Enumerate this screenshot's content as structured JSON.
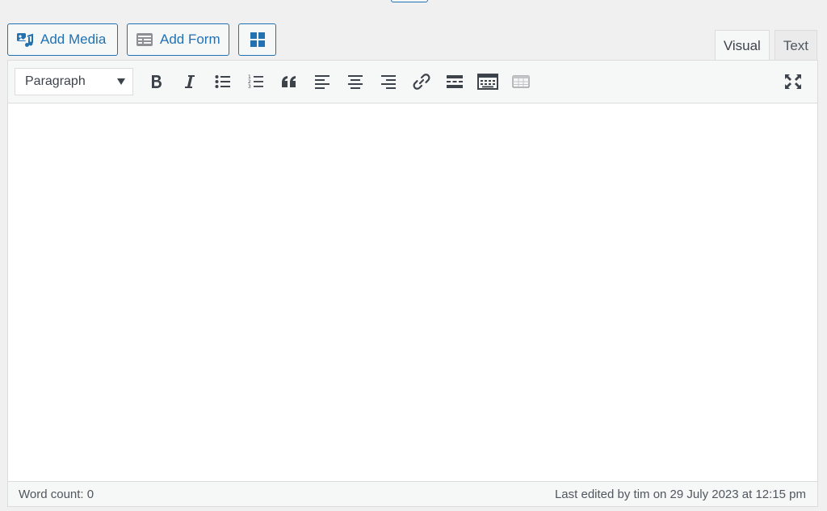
{
  "media_buttons": {
    "add_media": {
      "label": "Add Media",
      "icon": "add-media-icon"
    },
    "add_form": {
      "label": "Add Form",
      "icon": "form-icon"
    },
    "blocks": {
      "icon": "grid-icon"
    }
  },
  "tabs": [
    {
      "label": "Visual",
      "active": true
    },
    {
      "label": "Text",
      "active": false
    }
  ],
  "toolbar": {
    "format_select": {
      "value": "Paragraph"
    },
    "tools": [
      "bold-icon",
      "italic-icon",
      "bulleted-list-icon",
      "numbered-list-icon",
      "blockquote-icon",
      "align-left-icon",
      "align-center-icon",
      "align-right-icon",
      "link-icon",
      "read-more-icon",
      "toolbar-toggle-icon",
      "table-icon"
    ],
    "fullscreen": "fullscreen-icon"
  },
  "status": {
    "word_count": "Word count: 0",
    "last_edited": "Last edited by tim on 29 July 2023 at 12:15 pm"
  },
  "colors": {
    "accent": "#2271b1",
    "icon": "#3c434a",
    "background": "#f0f0f1"
  }
}
